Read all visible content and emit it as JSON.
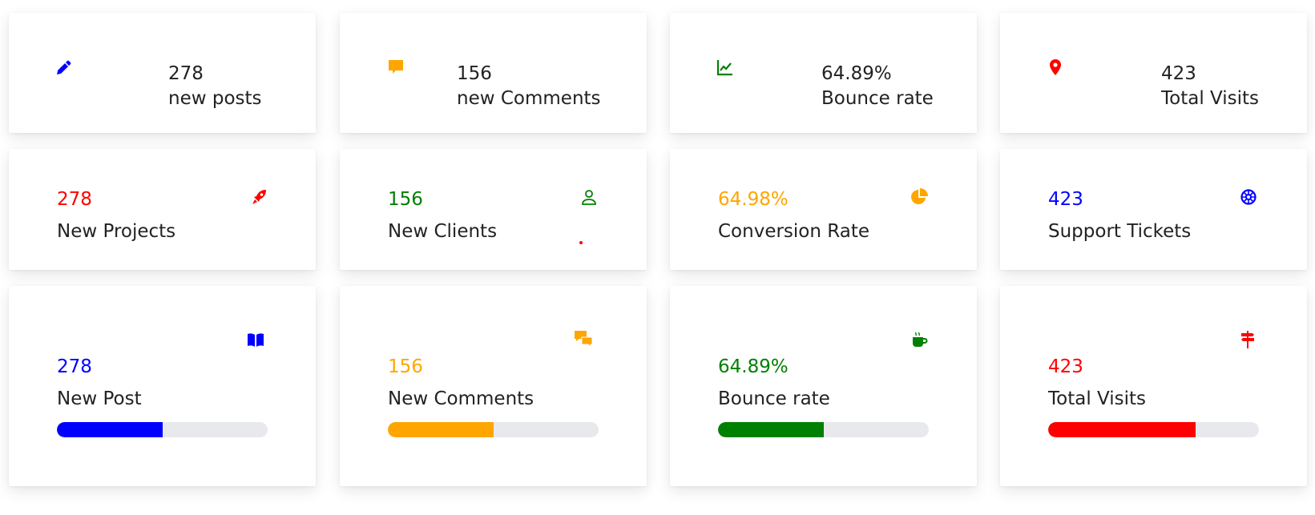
{
  "row1": [
    {
      "value": "278",
      "label": "new posts",
      "icon": "pencil-icon",
      "color": "#0000ff"
    },
    {
      "value": "156",
      "label": "new Comments",
      "icon": "comment-icon",
      "color": "#ffa500"
    },
    {
      "value": "64.89%",
      "label": "Bounce rate",
      "icon": "line-chart-icon",
      "color": "#008000"
    },
    {
      "value": "423",
      "label": "Total Visits",
      "icon": "map-pin-icon",
      "color": "#ff0000"
    }
  ],
  "row2": [
    {
      "value": "278",
      "label": "New Projects",
      "icon": "rocket-icon",
      "color": "#ff0000"
    },
    {
      "value": "156",
      "label": "New Clients",
      "icon": "user-icon",
      "color": "#008000"
    },
    {
      "value": "64.98%",
      "label": "Conversion Rate",
      "icon": "pie-chart-icon",
      "color": "#ffa500"
    },
    {
      "value": "423",
      "label": "Support Tickets",
      "icon": "life-ring-icon",
      "color": "#0000ff"
    }
  ],
  "row3": [
    {
      "value": "278",
      "label": "New Post",
      "icon": "book-icon",
      "color": "#0000ff",
      "progress_percent": 50
    },
    {
      "value": "156",
      "label": "New Comments",
      "icon": "comments-icon",
      "color": "#ffa500",
      "progress_percent": 50
    },
    {
      "value": "64.89%",
      "label": "Bounce rate",
      "icon": "coffee-cup-icon",
      "color": "#008000",
      "progress_percent": 50
    },
    {
      "value": "423",
      "label": "Total Visits",
      "icon": "signpost-icon",
      "color": "#ff0000",
      "progress_percent": 70
    }
  ]
}
